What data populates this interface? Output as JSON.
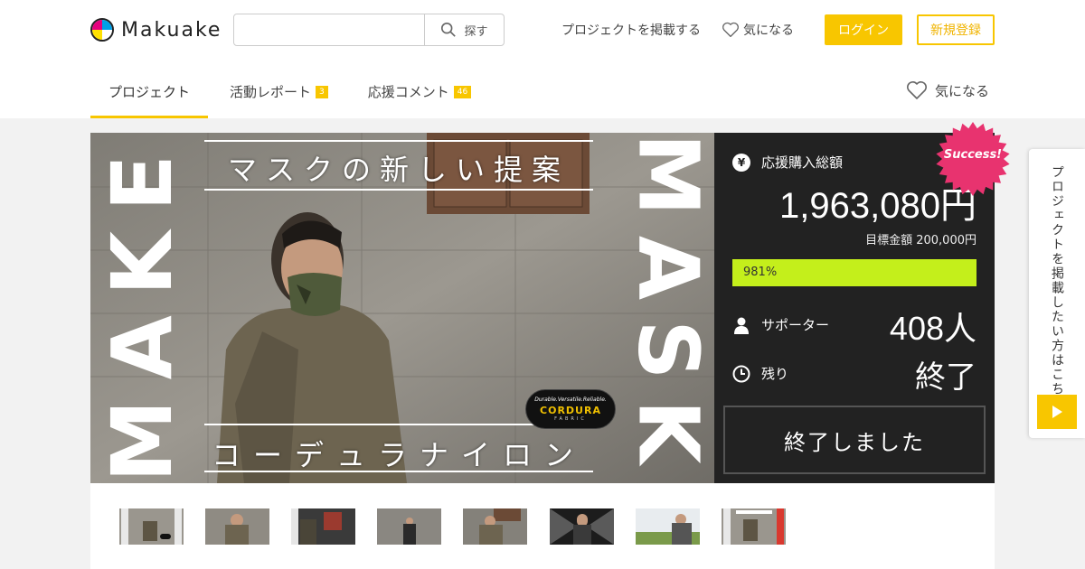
{
  "header": {
    "logo_text": "Makuake",
    "search": {
      "value": "",
      "placeholder": "",
      "button_label": "探す"
    },
    "post_project_label": "プロジェクトを掲載する",
    "favorite_label": "気になる",
    "login_label": "ログイン",
    "signup_label": "新規登録"
  },
  "tabs": [
    {
      "label": "プロジェクト",
      "badge": ""
    },
    {
      "label": "活動レポート",
      "badge": "3"
    },
    {
      "label": "応援コメント",
      "badge": "46"
    }
  ],
  "tab_favorite_label": "気になる",
  "hero": {
    "title": "マスクの新しい提案",
    "subtitle": "コーデュラナイロン",
    "side_left_word": "MAKE",
    "side_right_word": "MASK",
    "cordura": {
      "line1": "Durable.Versatile.Reliable.",
      "line2": "CORDURA",
      "line3": "FABRIC"
    }
  },
  "panel": {
    "total_label": "応援購入総額",
    "total_value": "1,963,080円",
    "goal_text": "目標金額 200,000円",
    "progress_text": "981%",
    "progress_fill_fraction": 1.0,
    "supporters_label": "サポーター",
    "supporters_value": "408人",
    "remaining_label": "残り",
    "remaining_value": "終了",
    "ended_label": "終了しました",
    "success_badge": "Success!"
  },
  "side_tab": {
    "text": "プロジェクトを掲載したい方はこちら"
  },
  "colors": {
    "accent": "#f8c600",
    "panel_bg": "#222222",
    "progress": "#c4ef1b"
  },
  "thumbnails_count": 8
}
